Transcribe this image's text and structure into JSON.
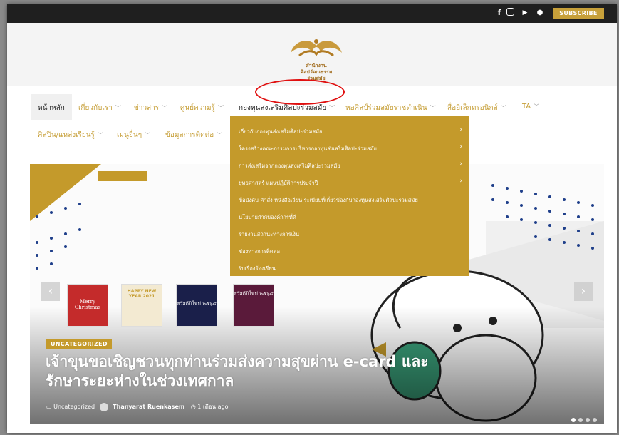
{
  "topbar": {
    "social": [
      {
        "icon": "facebook-icon",
        "glyph": "f"
      },
      {
        "icon": "instagram-icon",
        "glyph": "◎"
      },
      {
        "icon": "youtube-icon",
        "glyph": "▶"
      },
      {
        "icon": "chat-icon",
        "glyph": "●"
      }
    ],
    "subscribe_label": "SUBSCRIBE"
  },
  "logo": {
    "line1": "สำนักงาน",
    "line2": "ศิลปวัฒนธรรม",
    "line3": "ร่วมสมัย"
  },
  "nav": {
    "row1": [
      {
        "label": "หน้าหลัก",
        "chevron": false,
        "active": true
      },
      {
        "label": "เกี่ยวกับเรา",
        "chevron": true
      },
      {
        "label": "ข่าวสาร",
        "chevron": true
      },
      {
        "label": "ศูนย์ความรู้",
        "chevron": true
      },
      {
        "label": "กองทุนส่งเสริมศิลปะร่วมสมัย",
        "chevron": true,
        "dark": true
      },
      {
        "label": "หอศิลป์ร่วมสมัยราชดำเนิน",
        "chevron": true
      },
      {
        "label": "สื่ออิเล็กทรอนิกส์",
        "chevron": true
      },
      {
        "label": "ITA",
        "chevron": true
      }
    ],
    "row2": [
      {
        "label": "ศิลปิน/แหล่งเรียนรู้",
        "chevron": true
      },
      {
        "label": "เมนูอื่นๆ",
        "chevron": true
      },
      {
        "label": "ข้อมูลการติดต่อ",
        "chevron": true
      }
    ]
  },
  "dropdown": {
    "items": [
      {
        "label": "เกี่ยวกับกองทุนส่งเสริมศิลปะร่วมสมัย",
        "submenu": true
      },
      {
        "label": "โครงสร้างคณะกรรมการบริหารกองทุนส่งเสริมศิลปะร่วมสมัย",
        "submenu": true
      },
      {
        "label": "การส่งเสริมจากกองทุนส่งเสริมศิลปะร่วมสมัย",
        "submenu": true
      },
      {
        "label": "ยุทธศาสตร์ แผนปฏิบัติการประจำปี",
        "submenu": true
      },
      {
        "label": "ข้อบังคับ คำสั่ง หนังสือเวียน ระเบียบที่เกี่ยวข้องกับกองทุนส่งเสริมศิลปะร่วมสมัย",
        "submenu": false
      },
      {
        "label": "นโยบายกำกับองค์การที่ดี",
        "submenu": false
      },
      {
        "label": "รายงานสถานะทางการเงิน",
        "submenu": false
      },
      {
        "label": "ช่องทางการติดต่อ",
        "submenu": false
      },
      {
        "label": "รับเรื่องร้องเรียน",
        "submenu": false
      }
    ]
  },
  "hero": {
    "prev_icon": "‹",
    "next_icon": "›",
    "cards": [
      {
        "label": "Merry Christmas",
        "color": "#c42b2b"
      },
      {
        "label": "HAPPY NEW YEAR 2021",
        "color": "#f3ead2"
      },
      {
        "label": "สวัสดีปีใหม่ ๒๕๖๔",
        "color": "#1a1f4a"
      },
      {
        "label": "สวัสดีปีใหม่ ๒๕๖๔",
        "color": "#5a1a3a"
      }
    ],
    "category": "UNCATEGORIZED",
    "headline_line1": "เจ้าขุนขอเชิญชวนทุกท่านร่วมส่งความสุขผ่าน e-card และ",
    "headline_line2": "รักษาระยะห่างในช่วงเทศกาล",
    "meta_category": "Uncategorized",
    "meta_author": "Thanyarat Ruenkasem",
    "meta_time": "1 เดือน ago"
  },
  "colors": {
    "gold": "#c49a2b",
    "dark": "#1f1f1f",
    "red": "#e01010"
  }
}
